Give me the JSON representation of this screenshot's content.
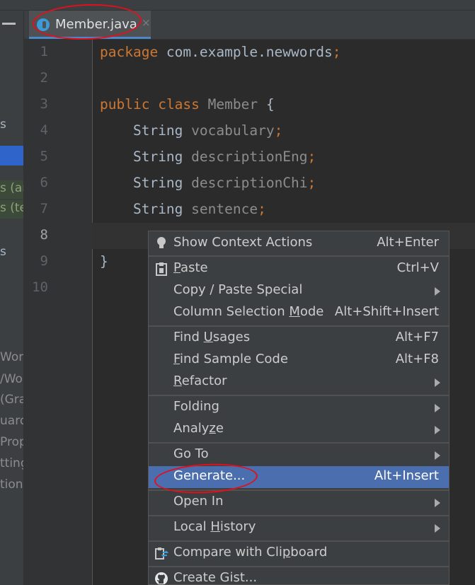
{
  "editor": {
    "tab": {
      "filename": "Member.java",
      "close_glyph": "×"
    },
    "line_numbers": [
      "1",
      "2",
      "3",
      "4",
      "5",
      "6",
      "7",
      "8",
      "9",
      "10"
    ],
    "code": {
      "l1_kw": "package",
      "l1_rest": " com.example.newwords",
      "l1_semi": ";",
      "l3_kw1": "public",
      "l3_kw2": "class",
      "l3_name": "Member",
      "l3_brace": " {",
      "l4_type": "String",
      "l4_field": "vocabulary",
      "semi": ";",
      "l5_type": "String",
      "l5_field": "descriptionEng",
      "l6_type": "String",
      "l6_field": "descriptionChi",
      "l7_type": "String",
      "l7_field": "sentence",
      "l9": "}"
    }
  },
  "left_panel": {
    "fragments": [
      "s",
      "s (ar",
      "s (te",
      "s",
      "Wor",
      "/Wor",
      "(Gra",
      "uard",
      "Prop",
      "tting",
      "tion"
    ]
  },
  "context_menu": {
    "items": {
      "show_context_actions": {
        "label": "Show Context Actions",
        "shortcut": "Alt+Enter",
        "icon": "lightbulb-icon"
      },
      "paste": {
        "pre": "",
        "mn": "P",
        "post": "aste",
        "shortcut": "Ctrl+V",
        "icon": "clipboard-icon"
      },
      "copy_paste_special": {
        "label": "Copy / Paste Special"
      },
      "column_selection_mode": {
        "pre": "Column Selection ",
        "mn": "M",
        "post": "ode",
        "shortcut": "Alt+Shift+Insert"
      },
      "find_usages": {
        "pre": "Find ",
        "mn": "U",
        "post": "sages",
        "shortcut": "Alt+F7"
      },
      "find_sample_code": {
        "pre": "",
        "mn": "F",
        "post": "ind Sample Code",
        "shortcut": "Alt+F8"
      },
      "refactor": {
        "pre": "",
        "mn": "R",
        "post": "efactor"
      },
      "folding": {
        "label": "Folding"
      },
      "analyze": {
        "pre": "Analy",
        "mn": "z",
        "post": "e"
      },
      "go_to": {
        "label": "Go To"
      },
      "generate": {
        "label": "Generate...",
        "shortcut": "Alt+Insert"
      },
      "open_in": {
        "label": "Open In"
      },
      "local_history": {
        "pre": "Local ",
        "mn": "H",
        "post": "istory"
      },
      "compare_with_clipboard": {
        "pre": "Compare with Cli",
        "mn": "p",
        "post": "board",
        "icon": "compare-clipboard-icon"
      },
      "create_gist": {
        "label": "Create Gist...",
        "icon": "github-icon"
      }
    },
    "selected": "generate"
  },
  "colors": {
    "editor_bg": "#2b2b2b",
    "keyword": "#cc7832",
    "field": "#9876aa",
    "menu_bg": "#3c3f41",
    "menu_selected": "#4b6eaf",
    "annotation": "#e0101c"
  }
}
